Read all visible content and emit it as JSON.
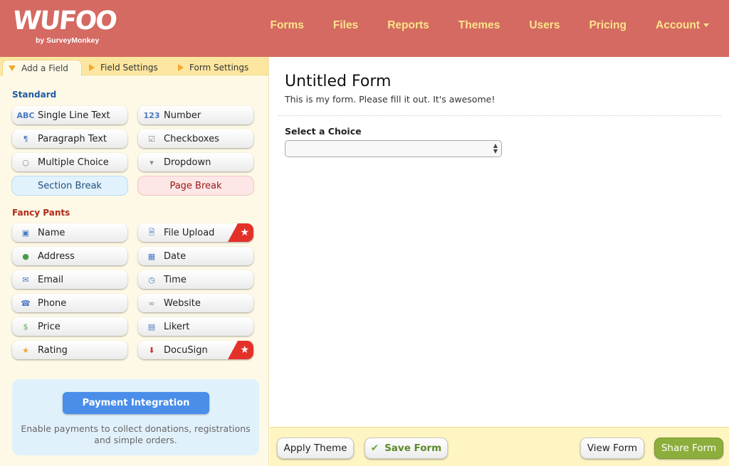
{
  "header": {
    "logo_text": "WUFOO",
    "logo_sub": "by SurveyMonkey",
    "nav": [
      "Forms",
      "Files",
      "Reports",
      "Themes",
      "Users",
      "Pricing",
      "Account"
    ]
  },
  "sidebar": {
    "tabs": [
      {
        "label": "Add a Field",
        "active": true
      },
      {
        "label": "Field Settings",
        "active": false
      },
      {
        "label": "Form Settings",
        "active": false
      }
    ],
    "standard_title": "Standard",
    "standard": [
      {
        "label": "Single Line Text",
        "icon": "abc-icon",
        "glyph": "ABC"
      },
      {
        "label": "Number",
        "icon": "number-icon",
        "glyph": "123"
      },
      {
        "label": "Paragraph Text",
        "icon": "paragraph-icon",
        "glyph": "¶"
      },
      {
        "label": "Checkboxes",
        "icon": "checkbox-icon",
        "glyph": "☑"
      },
      {
        "label": "Multiple Choice",
        "icon": "radio-icon",
        "glyph": "○"
      },
      {
        "label": "Dropdown",
        "icon": "dropdown-icon",
        "glyph": "▾"
      }
    ],
    "section_break": "Section Break",
    "page_break": "Page Break",
    "fancy_title": "Fancy Pants",
    "fancy": [
      {
        "label": "Name",
        "icon": "name-card-icon",
        "glyph": "▣"
      },
      {
        "label": "File Upload",
        "icon": "file-upload-icon",
        "glyph": "🗎",
        "premium": true
      },
      {
        "label": "Address",
        "icon": "globe-icon",
        "glyph": "●"
      },
      {
        "label": "Date",
        "icon": "calendar-icon",
        "glyph": "▦"
      },
      {
        "label": "Email",
        "icon": "envelope-icon",
        "glyph": "✉"
      },
      {
        "label": "Time",
        "icon": "clock-icon",
        "glyph": "◷"
      },
      {
        "label": "Phone",
        "icon": "phone-icon",
        "glyph": "☎"
      },
      {
        "label": "Website",
        "icon": "link-icon",
        "glyph": "∞"
      },
      {
        "label": "Price",
        "icon": "money-icon",
        "glyph": "$"
      },
      {
        "label": "Likert",
        "icon": "table-icon",
        "glyph": "▤"
      },
      {
        "label": "Rating",
        "icon": "star-icon",
        "glyph": "★"
      },
      {
        "label": "DocuSign",
        "icon": "docusign-icon",
        "glyph": "⬇",
        "premium": true
      }
    ],
    "premium_glyph": "★",
    "payment": {
      "button": "Payment Integration",
      "description": "Enable payments to collect donations, registrations and simple orders."
    }
  },
  "form": {
    "title": "Untitled Form",
    "description": "This is my form. Please fill it out. It's awesome!",
    "field_label": "Select a Choice",
    "field_value": ""
  },
  "footer": {
    "apply_theme": "Apply Theme",
    "save_form": "Save Form",
    "view_form": "View Form",
    "share_form": "Share Form"
  },
  "colors": {
    "header": "#d46a62",
    "nav_text": "#fce38a",
    "standard_title": "#1f5aa6",
    "fancy_title": "#b02a1a",
    "payment_button": "#4a8eea",
    "share_button": "#8cae3c",
    "premium_badge": "#e3312a"
  }
}
